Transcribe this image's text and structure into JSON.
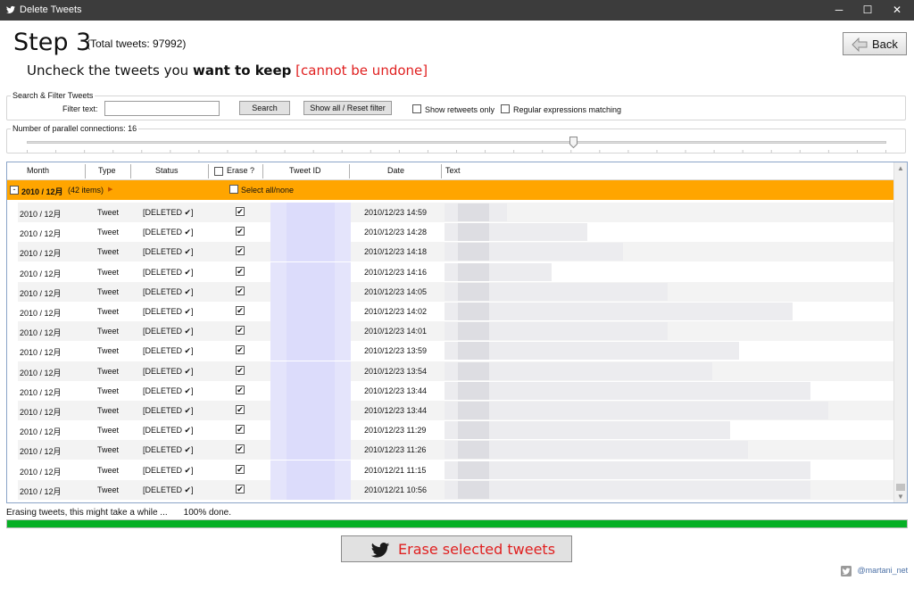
{
  "window": {
    "title": "Delete Tweets",
    "minimize": "─",
    "maximize": "☐",
    "close": "✕"
  },
  "header": {
    "step": "Step 3",
    "total": "(Total tweets: 97992)",
    "subtitle_prefix": "Uncheck the tweets you ",
    "subtitle_bold": "want to keep",
    "subtitle_warning": "[cannot be undone]",
    "back_label": "Back"
  },
  "filter": {
    "group_label": "Search & Filter Tweets",
    "filter_label": "Filter text:",
    "filter_value": "",
    "search_label": "Search",
    "show_all_label": "Show all / Reset filter",
    "retweets_only_label": "Show retweets only",
    "retweets_only_checked": false,
    "regex_label": "Regular expressions matching",
    "regex_checked": false
  },
  "connections": {
    "label": "Number of parallel connections: 16",
    "value": 16
  },
  "grid": {
    "columns": [
      "Month",
      "Type",
      "Status",
      "Erase ?",
      "Tweet ID",
      "Date",
      "Text"
    ],
    "erase_header_checked": false,
    "group": {
      "toggle": "-",
      "title": "2010 / 12月",
      "count": "(42 items)",
      "select_all_label": "Select all/none",
      "select_all_checked": false
    },
    "rows": [
      {
        "month": "2010 / 12月",
        "type": "Tweet",
        "status": "[DELETED ✔]",
        "erase": true,
        "date": "2010/12/23 14:59"
      },
      {
        "month": "2010 / 12月",
        "type": "Tweet",
        "status": "[DELETED ✔]",
        "erase": true,
        "date": "2010/12/23 14:28"
      },
      {
        "month": "2010 / 12月",
        "type": "Tweet",
        "status": "[DELETED ✔]",
        "erase": true,
        "date": "2010/12/23 14:18"
      },
      {
        "month": "2010 / 12月",
        "type": "Tweet",
        "status": "[DELETED ✔]",
        "erase": true,
        "date": "2010/12/23 14:16"
      },
      {
        "month": "2010 / 12月",
        "type": "Tweet",
        "status": "[DELETED ✔]",
        "erase": true,
        "date": "2010/12/23 14:05"
      },
      {
        "month": "2010 / 12月",
        "type": "Tweet",
        "status": "[DELETED ✔]",
        "erase": true,
        "date": "2010/12/23 14:02"
      },
      {
        "month": "2010 / 12月",
        "type": "Tweet",
        "status": "[DELETED ✔]",
        "erase": true,
        "date": "2010/12/23 14:01"
      },
      {
        "month": "2010 / 12月",
        "type": "Tweet",
        "status": "[DELETED ✔]",
        "erase": true,
        "date": "2010/12/23 13:59"
      },
      {
        "month": "2010 / 12月",
        "type": "Tweet",
        "status": "[DELETED ✔]",
        "erase": true,
        "date": "2010/12/23 13:54"
      },
      {
        "month": "2010 / 12月",
        "type": "Tweet",
        "status": "[DELETED ✔]",
        "erase": true,
        "date": "2010/12/23 13:44"
      },
      {
        "month": "2010 / 12月",
        "type": "Tweet",
        "status": "[DELETED ✔]",
        "erase": true,
        "date": "2010/12/23 13:44"
      },
      {
        "month": "2010 / 12月",
        "type": "Tweet",
        "status": "[DELETED ✔]",
        "erase": true,
        "date": "2010/12/23 11:29"
      },
      {
        "month": "2010 / 12月",
        "type": "Tweet",
        "status": "[DELETED ✔]",
        "erase": true,
        "date": "2010/12/23 11:26"
      },
      {
        "month": "2010 / 12月",
        "type": "Tweet",
        "status": "[DELETED ✔]",
        "erase": true,
        "date": "2010/12/21 11:15"
      },
      {
        "month": "2010 / 12月",
        "type": "Tweet",
        "status": "[DELETED ✔]",
        "erase": true,
        "date": "2010/12/21 10:56"
      }
    ]
  },
  "progress": {
    "status_text": "Erasing tweets, this might take a while ...",
    "percent_text": "100% done.",
    "percent": 100,
    "color": "#06b025"
  },
  "erase_button": {
    "label": "Erase selected tweets",
    "color": "#e02020",
    "icon": "twitter-bird-icon"
  },
  "credit": {
    "label": "@martani_net",
    "icon": "twitter-bird-icon"
  },
  "colors": {
    "group_highlight": "#ffa500",
    "accent_red": "#e02020",
    "progress_green": "#06b025"
  }
}
